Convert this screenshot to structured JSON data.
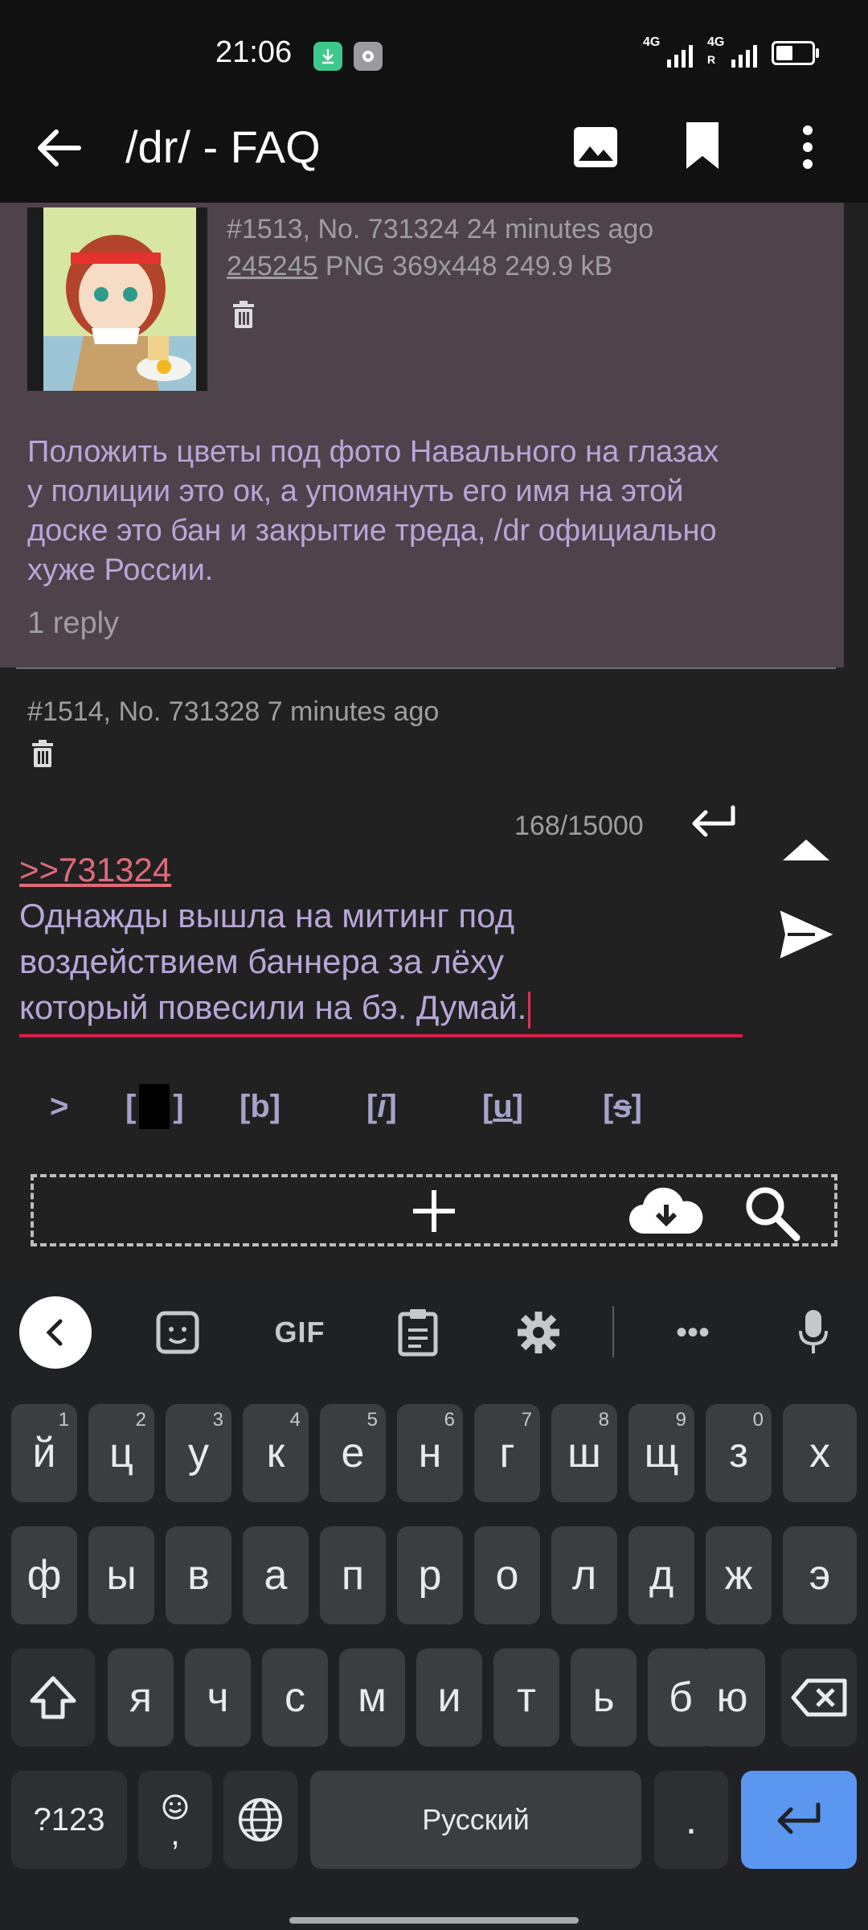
{
  "status_bar": {
    "time": "21:06",
    "network1": "4G",
    "network2": "4G",
    "network2_sub": "R"
  },
  "toolbar": {
    "title": "/dr/ - FAQ"
  },
  "posts": [
    {
      "meta": "#1513, No. 731324 24 minutes ago",
      "file_name": "245245",
      "file_info": " PNG 369x448 249.9 kB",
      "text_lines": [
        "Положить цветы под фото Навального на глазах",
        "у полиции это ок, а упомянуть его имя на этой",
        "доске это бан и закрытие треда, /dr официально",
        "хуже России."
      ],
      "replies": "1 reply"
    },
    {
      "meta": "#1514, No. 731328 7 minutes ago"
    }
  ],
  "reply": {
    "counter": "168/15000",
    "quote": ">>731324",
    "lines": [
      "Однажды вышла на митинг под",
      "воздействием баннера за лёху",
      "который повесили на бэ. Думай."
    ]
  },
  "format_buttons": {
    "quote": ">",
    "spoiler_open": "[",
    "spoiler_close": "]",
    "bold_open": "[",
    "bold": "b",
    "bold_close": "]",
    "italic_open": "[",
    "italic": "i",
    "italic_close": "]",
    "underline_open": "[",
    "underline": "u",
    "underline_close": "]",
    "strike_open": "[",
    "strike": "s",
    "strike_close": "]"
  },
  "keyboard": {
    "gif_label": "GIF",
    "dots": "•••",
    "row1": [
      {
        "k": "й",
        "s": "1"
      },
      {
        "k": "ц",
        "s": "2"
      },
      {
        "k": "у",
        "s": "3"
      },
      {
        "k": "к",
        "s": "4"
      },
      {
        "k": "е",
        "s": "5"
      },
      {
        "k": "н",
        "s": "6"
      },
      {
        "k": "г",
        "s": "7"
      },
      {
        "k": "ш",
        "s": "8"
      },
      {
        "k": "щ",
        "s": "9"
      },
      {
        "k": "з",
        "s": "0"
      },
      {
        "k": "х",
        "s": ""
      }
    ],
    "row2": [
      "ф",
      "ы",
      "в",
      "а",
      "п",
      "р",
      "о",
      "л",
      "д",
      "ж",
      "э"
    ],
    "row3": [
      "я",
      "ч",
      "с",
      "м",
      "и",
      "т",
      "ь",
      "б",
      "ю"
    ],
    "symbols": "?123",
    "emoji_comma": ",",
    "space": "Русский",
    "period": "."
  },
  "colors": {
    "post_bg": "#4e434b",
    "post_text": "#b8a6d8",
    "quote_link": "#e06b79",
    "accent": "#d81e4a",
    "enter_key": "#5b96f0"
  }
}
